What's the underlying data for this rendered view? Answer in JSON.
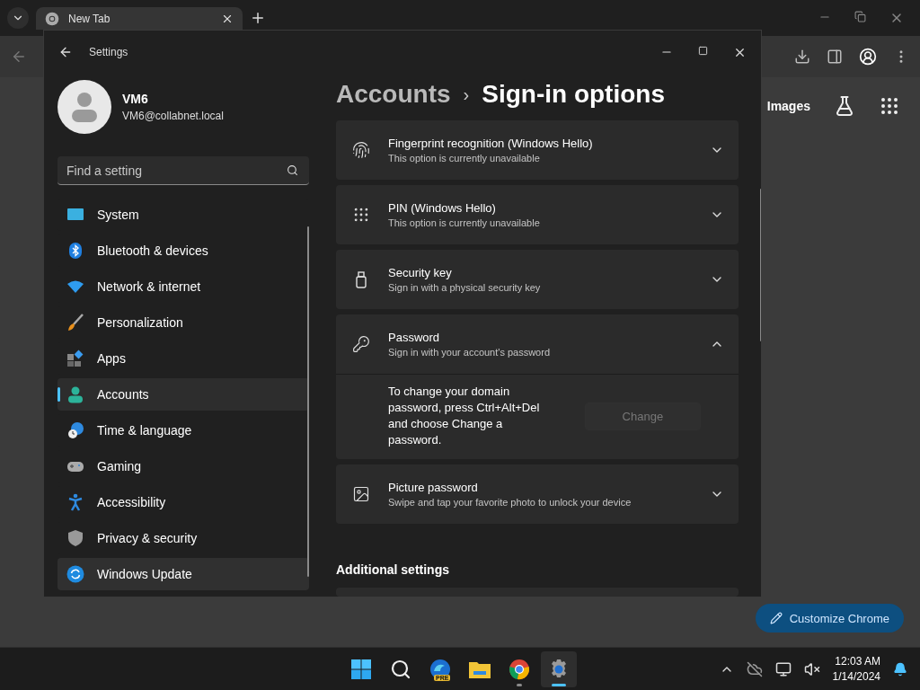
{
  "browser": {
    "tab": {
      "title": "New Tab",
      "selected": true
    },
    "header_links": [
      {
        "label": "Images"
      }
    ],
    "customize_button": {
      "label": "Customize Chrome"
    }
  },
  "settings": {
    "title": "Settings",
    "user": {
      "name": "VM6",
      "email": "VM6@collabnet.local"
    },
    "search": {
      "placeholder": "Find a setting"
    },
    "nav": [
      {
        "label": "System",
        "kind": "system",
        "selected": false,
        "hovered": false
      },
      {
        "label": "Bluetooth & devices",
        "kind": "bluetooth",
        "selected": false,
        "hovered": false
      },
      {
        "label": "Network & internet",
        "kind": "network",
        "selected": false,
        "hovered": false
      },
      {
        "label": "Personalization",
        "kind": "brush",
        "selected": false,
        "hovered": false
      },
      {
        "label": "Apps",
        "kind": "apps",
        "selected": false,
        "hovered": false
      },
      {
        "label": "Accounts",
        "kind": "accounts",
        "selected": true,
        "hovered": false
      },
      {
        "label": "Time & language",
        "kind": "time",
        "selected": false,
        "hovered": false
      },
      {
        "label": "Gaming",
        "kind": "gaming",
        "selected": false,
        "hovered": false
      },
      {
        "label": "Accessibility",
        "kind": "accessibility",
        "selected": false,
        "hovered": false
      },
      {
        "label": "Privacy & security",
        "kind": "shield",
        "selected": false,
        "hovered": false
      },
      {
        "label": "Windows Update",
        "kind": "update",
        "selected": false,
        "hovered": true
      }
    ],
    "breadcrumb": {
      "parent": "Accounts",
      "separator": "›",
      "current": "Sign-in options"
    },
    "options": [
      {
        "kind": "fingerprint",
        "title": "Fingerprint recognition (Windows Hello)",
        "subtitle": "This option is currently unavailable",
        "expanded": false
      },
      {
        "kind": "pin",
        "title": "PIN (Windows Hello)",
        "subtitle": "This option is currently unavailable",
        "expanded": false
      },
      {
        "kind": "security-key",
        "title": "Security key",
        "subtitle": "Sign in with a physical security key",
        "expanded": false
      },
      {
        "kind": "key",
        "title": "Password",
        "subtitle": "Sign in with your account's password",
        "expanded": true,
        "detail": "To change your domain password, press Ctrl+Alt+Del and choose Change a password.",
        "action": {
          "label": "Change",
          "disabled": true
        }
      },
      {
        "kind": "picture",
        "title": "Picture password",
        "subtitle": "Swipe and tap your favorite photo to unlock your device",
        "expanded": false
      }
    ],
    "section_title": "Additional settings"
  },
  "taskbar": {
    "apps": [
      {
        "kind": "start",
        "running": false,
        "active": false
      },
      {
        "kind": "search",
        "running": false,
        "active": false
      },
      {
        "kind": "edge",
        "badge": "PRE",
        "running": false,
        "active": false
      },
      {
        "kind": "explorer",
        "running": false,
        "active": false
      },
      {
        "kind": "chrome",
        "running": true,
        "active": false
      },
      {
        "kind": "settings",
        "running": true,
        "active": true
      }
    ],
    "clock": {
      "time": "12:03 AM",
      "date": "1/14/2024"
    }
  }
}
